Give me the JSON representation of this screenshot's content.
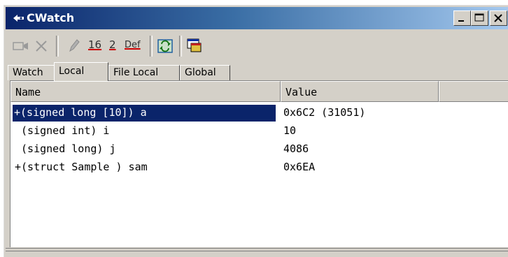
{
  "window": {
    "title": "CWatch",
    "controls": [
      "minimize-icon",
      "maximize-icon",
      "close-icon"
    ]
  },
  "toolbar": {
    "icons": [
      "add-watch-icon",
      "delete-icon",
      "edit-icon",
      "radix-hex-button",
      "radix-binary-button",
      "radix-default-button",
      "refresh-icon",
      "register-window-icon"
    ],
    "hex_label": "16",
    "bin_label": "2",
    "def_label": "Def"
  },
  "tabs": [
    {
      "label": "Watch",
      "active": false
    },
    {
      "label": "Local",
      "active": true
    },
    {
      "label": "File Local",
      "active": false
    },
    {
      "label": "Global",
      "active": false
    }
  ],
  "columns": {
    "name": "Name",
    "value": "Value"
  },
  "rows": [
    {
      "name": "+(signed long [10]) a",
      "value": "0x6C2 (31051)",
      "selected": true
    },
    {
      "name": " (signed int) i",
      "value": "10",
      "selected": false
    },
    {
      "name": " (signed long) j",
      "value": "4086",
      "selected": false
    },
    {
      "name": "+(struct Sample ) sam",
      "value": "0x6EA",
      "selected": false
    }
  ],
  "colors": {
    "title_start": "#0a246a",
    "title_end": "#a6caf0",
    "selection": "#0a246a",
    "face": "#d4d0c8"
  }
}
